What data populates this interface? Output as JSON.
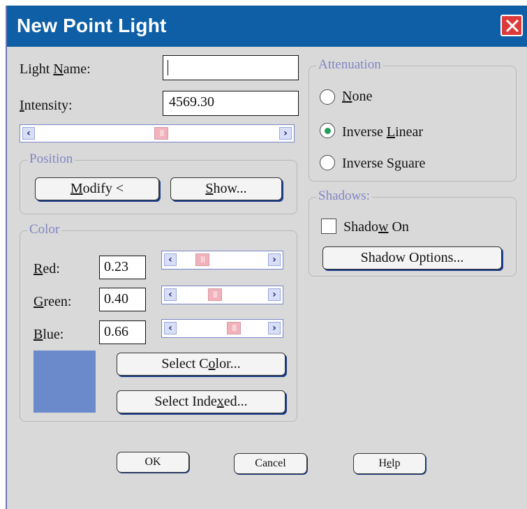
{
  "window": {
    "title": "New Point Light",
    "close_symbol": "×"
  },
  "light_name": {
    "label_pre": "Light ",
    "label_key": "N",
    "label_post": "ame:",
    "value": ""
  },
  "intensity": {
    "label_pre": "",
    "label_key": "I",
    "label_post": "ntensity:",
    "value": "4569.30",
    "slider_fraction": 0.52
  },
  "position_group": {
    "title": "Position",
    "modify": {
      "pre": "",
      "key": "M",
      "post": "odify <"
    },
    "show": {
      "pre": "",
      "key": "S",
      "post": "how..."
    }
  },
  "color_group": {
    "title": "Color",
    "red": {
      "label_pre": "",
      "label_key": "R",
      "label_post": "ed:",
      "value": "0.23",
      "fraction": 0.23
    },
    "green": {
      "label_pre": "",
      "label_key": "G",
      "label_post": "reen:",
      "value": "0.40",
      "fraction": 0.4
    },
    "blue": {
      "label_pre": "",
      "label_key": "B",
      "label_post": "lue:",
      "value": "0.66",
      "fraction": 0.66
    },
    "swatch_color": "#6b8acb",
    "select_color": {
      "pre": "Select C",
      "key": "o",
      "post": "lor..."
    },
    "select_indexed": {
      "pre": "Select Inde",
      "key": "x",
      "post": "ed..."
    }
  },
  "attenuation": {
    "title": "Attenuation",
    "options": [
      {
        "pre": "",
        "key": "N",
        "post": "one",
        "selected": false
      },
      {
        "pre": "Inverse ",
        "key": "L",
        "post": "inear",
        "selected": true
      },
      {
        "pre": "Inverse S",
        "key": "g",
        "post": "uare",
        "selected": false
      }
    ]
  },
  "shadows": {
    "title": "Shadows:",
    "shadow_on": {
      "pre": "Shado",
      "key": "w",
      "post": " On",
      "checked": false
    },
    "options_button": "Shadow Options..."
  },
  "footer": {
    "ok": "OK",
    "cancel": "Cancel",
    "help": {
      "pre": "H",
      "key": "e",
      "post": "lp"
    }
  },
  "icons": {
    "close": "close-icon",
    "scroll_left": "chevron-left-icon",
    "scroll_right": "chevron-right-icon",
    "thumb": "grip-icon"
  },
  "colors": {
    "titlebar": "#0e5fa6",
    "close": "#dd3a3a",
    "radio_selected": "#1fa05a",
    "group_title": "#8285c4"
  }
}
